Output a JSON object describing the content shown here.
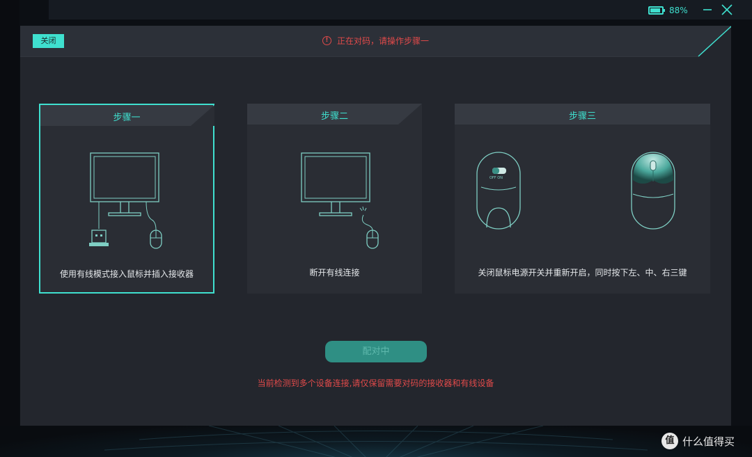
{
  "titlebar": {
    "battery_percent": "88%",
    "battery_level": 0.88,
    "accent_color": "#3fe0cf"
  },
  "dialog": {
    "close_label": "关闭",
    "status_text": "正在对码，请操作步骤一",
    "status_color": "#e04a4a",
    "steps": [
      {
        "title": "步骤一",
        "text": "使用有线模式接入鼠标并插入接收器",
        "active": true,
        "icon": "monitor-receiver-mouse-illustration"
      },
      {
        "title": "步骤二",
        "text": "断开有线连接",
        "active": false,
        "icon": "monitor-disconnect-mouse-illustration"
      },
      {
        "title": "步骤三",
        "text": "关闭鼠标电源开关并重新开启，同时按下左、中、右三键",
        "active": false,
        "icon": "mouse-power-switch-illustration"
      }
    ],
    "pair_button_label": "配对中",
    "bottom_warning": "当前检测到多个设备连接,请仅保留需要对码的接收器和有线设备"
  },
  "watermark": {
    "badge": "值",
    "text": "什么值得买"
  }
}
